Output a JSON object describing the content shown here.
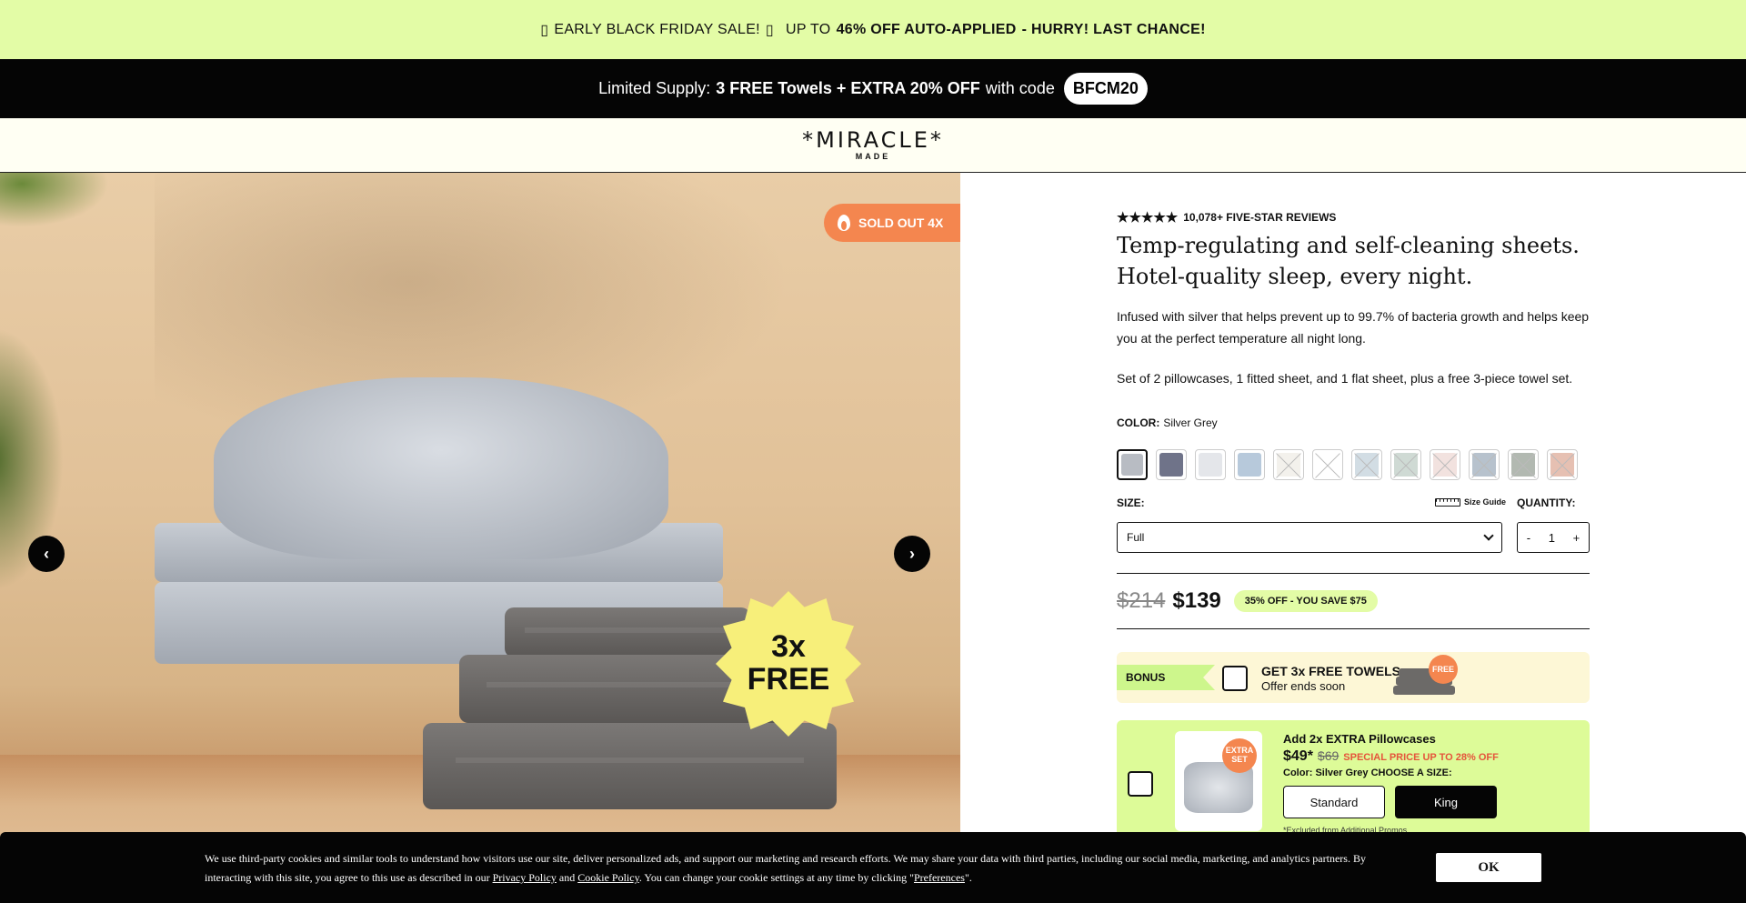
{
  "promo": {
    "icon_left": "▯",
    "part1": "EARLY BLACK FRIDAY SALE!",
    "icon_right": "▯",
    "part2": "UP TO",
    "part3": "46% OFF AUTO-APPLIED",
    "part4": "- HURRY! LAST CHANCE!"
  },
  "code_bar": {
    "prefix": "Limited Supply:",
    "offer": "3 FREE Towels + EXTRA 20% OFF",
    "with_code": "with code",
    "code": "BFCM20"
  },
  "header": {
    "logo_word": "*MIRACLE*",
    "logo_sub": "MADE"
  },
  "gallery": {
    "badge_sold_out": "SOLD OUT 4X",
    "burst_line1": "3x",
    "burst_line2": "FREE",
    "prev_arrow": "‹",
    "next_arrow": "›"
  },
  "product": {
    "stars": "★★★★★",
    "reviews": "10,078+ FIVE-STAR REVIEWS",
    "headline_line1": "Temp-regulating and self-cleaning sheets.",
    "headline_line2": "Hotel-quality sleep, every night.",
    "description": "Infused with silver that helps prevent up to 99.7% of bacteria growth and helps keep you at the perfect temperature all night long.",
    "set_contents": "Set of 2 pillowcases, 1 fitted sheet, and 1 flat sheet, plus a free 3-piece towel set.",
    "color_label": "COLOR:",
    "color_value": "Silver Grey",
    "swatches": [
      {
        "color": "#b8bcc3",
        "active": true
      },
      {
        "color": "#6f7389"
      },
      {
        "color": "#e4e6ea"
      },
      {
        "color": "#b7c9db"
      },
      {
        "color": "#f3f1ec",
        "crossed": true
      },
      {
        "color": "#ffffff",
        "crossed": true
      },
      {
        "color": "#d2dde4",
        "crossed": true
      },
      {
        "color": "#cfdad4",
        "crossed": true
      },
      {
        "color": "#f2e2df",
        "crossed": true
      },
      {
        "color": "#b7c2cd",
        "crossed": true
      },
      {
        "color": "#b2b9b1",
        "crossed": true
      },
      {
        "color": "#e6c0b2",
        "crossed": true
      }
    ],
    "size_label": "SIZE:",
    "size_guide": "Size Guide",
    "quantity_label": "QUANTITY:",
    "size_value": "Full",
    "qty_minus": "-",
    "qty_value": "1",
    "qty_plus": "+",
    "old_price": "$214",
    "new_price": "$139",
    "savings": "35% OFF - YOU SAVE $75"
  },
  "bonus": {
    "tag": "BONUS",
    "title": "GET 3x FREE TOWELS",
    "subtitle": "Offer ends soon",
    "free_tag": "FREE"
  },
  "upsell": {
    "badge_line1": "EXTRA",
    "badge_line2": "SET",
    "title": "Add 2x EXTRA Pillowcases",
    "price": "$49*",
    "old_price": "$69",
    "special": "SPECIAL PRICE UP TO 28% OFF",
    "color_line": "Color: Silver Grey CHOOSE A SIZE:",
    "size_standard": "Standard",
    "size_king": "King",
    "note": "*Excluded from Additional Promos"
  },
  "cookie": {
    "text1": "We use third-party cookies and similar tools to understand how visitors use our site, deliver personalized ads, and support our marketing and research efforts. We may share your data with third parties, including our social media, marketing, and analytics partners. By interacting with this site, you agree to this use as described in our",
    "privacy_link": "Privacy Policy",
    "and": "and",
    "cookie_link": "Cookie Policy",
    "text2": ". You can change your cookie settings at any time by clicking \"",
    "preferences_link": "Preferences",
    "text3": "\".",
    "ok": "OK"
  }
}
